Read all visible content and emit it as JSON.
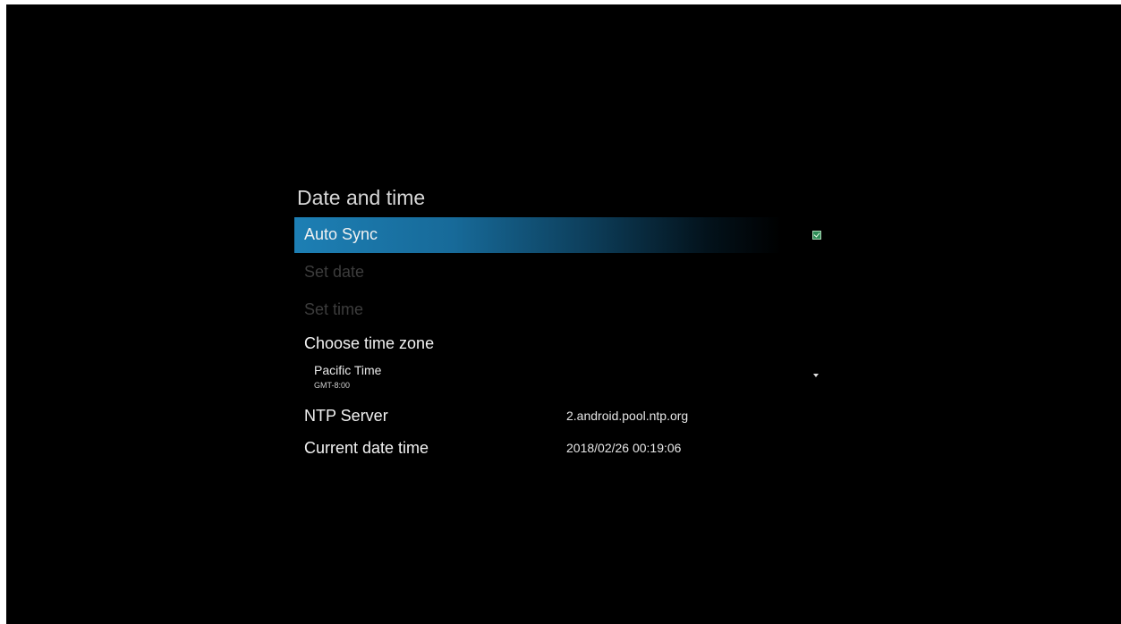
{
  "page": {
    "title": "Date and time"
  },
  "settings": {
    "auto_sync": {
      "label": "Auto Sync",
      "checked": true,
      "icon": "checkbox-checked-icon"
    },
    "set_date": {
      "label": "Set date",
      "enabled": false
    },
    "set_time": {
      "label": "Set time",
      "enabled": false
    },
    "time_zone": {
      "label": "Choose time zone",
      "selected_name": "Pacific Time",
      "selected_offset": "GMT-8:00",
      "icon": "dropdown-arrow-icon"
    },
    "ntp_server": {
      "label": "NTP Server",
      "value": "2.android.pool.ntp.org"
    },
    "current_datetime": {
      "label": "Current date time",
      "value": "2018/02/26 00:19:06"
    }
  },
  "colors": {
    "highlight": "#1d7fb4",
    "background": "#000000",
    "checkbox": "#2e8b57"
  }
}
